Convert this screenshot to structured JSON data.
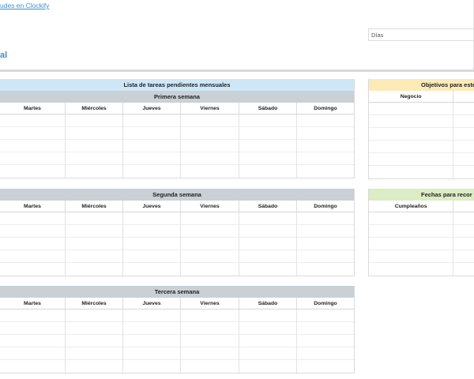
{
  "header": {
    "link_text": "udes en Clockify",
    "sheet_title": "al",
    "days_label": "Días"
  },
  "monthly": {
    "title": "Lista de tareas pendientes mensuales",
    "days": [
      "Martes",
      "Miércoles",
      "Jueves",
      "Viernes",
      "Sábado",
      "Domingo"
    ],
    "weeks": [
      {
        "label": "Primera semana"
      },
      {
        "label": "Segunda semana"
      },
      {
        "label": "Tercera semana"
      }
    ]
  },
  "goals": {
    "title": "Objetivos para este",
    "col1": "Negocio"
  },
  "dates": {
    "title": "Fechas para recor",
    "col1": "Cumpleaños"
  },
  "colors": {
    "link": "#3a8fd0",
    "band_blue": "#cde7f7",
    "band_gray": "#c9d0d6",
    "band_yellow": "#fcebb6",
    "band_green": "#dcecc4"
  }
}
